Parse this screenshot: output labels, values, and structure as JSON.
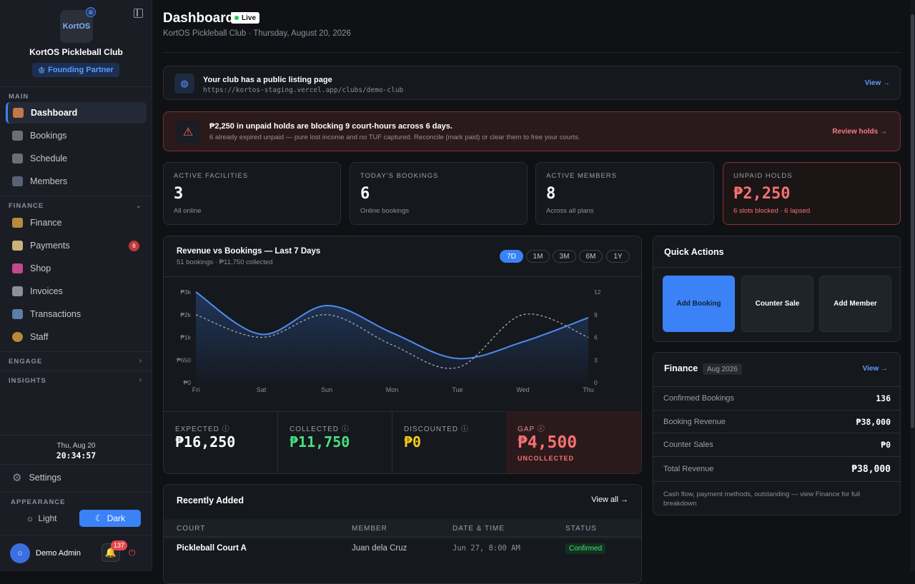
{
  "sidebar": {
    "logo_text": "KortOS",
    "club_name": "KortOS Pickleball Club",
    "partner_badge": "Founding Partner",
    "sections": {
      "main": "MAIN",
      "finance": "FINANCE",
      "engage": "ENGAGE",
      "insights": "INSIGHTS",
      "appearance": "APPEARANCE"
    },
    "main_items": [
      {
        "label": "Dashboard",
        "icon": "house-icon"
      },
      {
        "label": "Bookings",
        "icon": "calendar-icon"
      },
      {
        "label": "Schedule",
        "icon": "calendar-icon"
      },
      {
        "label": "Members",
        "icon": "people-icon"
      }
    ],
    "finance_items": [
      {
        "label": "Finance",
        "icon": "money-bag-icon"
      },
      {
        "label": "Payments",
        "icon": "credit-card-icon",
        "badge": "6"
      },
      {
        "label": "Shop",
        "icon": "shopping-bags-icon"
      },
      {
        "label": "Invoices",
        "icon": "document-icon"
      },
      {
        "label": "Transactions",
        "icon": "exchange-icon"
      },
      {
        "label": "Staff",
        "icon": "staff-icon"
      }
    ],
    "clock_date": "Thu, Aug 20",
    "clock_time": "20:34:57",
    "settings": "Settings",
    "theme_light": "Light",
    "theme_dark": "Dark",
    "user_name": "Demo Admin",
    "notifications": "137"
  },
  "header": {
    "title": "Dashboard",
    "live": "Live",
    "subtitle": "KortOS Pickleball Club · Thursday, August 20, 2026"
  },
  "public_listing": {
    "title": "Your club has a public listing page",
    "url": "https://kortos-staging.vercel.app/clubs/demo-club",
    "link": "View →"
  },
  "alert": {
    "title": "₱2,250 in unpaid holds are blocking 9 court-hours across 6 days.",
    "body": "6 already expired unpaid — pure lost income and no TUF captured. Reconcile (mark paid) or clear them to free your courts.",
    "link": "Review holds →"
  },
  "stats": [
    {
      "label": "ACTIVE FACILITIES",
      "value": "3",
      "sub": "All online"
    },
    {
      "label": "TODAY'S BOOKINGS",
      "value": "6",
      "sub": "Online bookings"
    },
    {
      "label": "ACTIVE MEMBERS",
      "value": "8",
      "sub": "Across all plans"
    },
    {
      "label": "UNPAID HOLDS",
      "value": "₱2,250",
      "sub": "6 slots blocked · 6 lapsed"
    }
  ],
  "revenue": {
    "title": "Revenue vs Bookings — Last 7 Days",
    "subtitle": "51 bookings · ₱11,750 collected",
    "ranges": [
      "7D",
      "1M",
      "3M",
      "6M",
      "1Y"
    ],
    "kpis": [
      {
        "label": "EXPECTED",
        "value": "₱16,250",
        "color": "#ffffff"
      },
      {
        "label": "COLLECTED",
        "value": "₱11,750",
        "color": "#4ade80"
      },
      {
        "label": "DISCOUNTED",
        "value": "₱0",
        "color": "#facc15"
      },
      {
        "label": "GAP",
        "value": "₱4,500",
        "color": "#f87171",
        "sub": "UNCOLLECTED"
      }
    ]
  },
  "chart_data": {
    "type": "line",
    "categories": [
      "Fri",
      "Sat",
      "Sun",
      "Mon",
      "Tue",
      "Wed",
      "Thu"
    ],
    "y_left_ticks": [
      "₱0",
      "₱650",
      "₱1k",
      "₱2k",
      "₱3k"
    ],
    "y_right_ticks": [
      "0",
      "3",
      "6",
      "9",
      "12"
    ],
    "series": [
      {
        "values": [
          3000,
          1600,
          2550,
          1650,
          800,
          1350,
          2150
        ],
        "color": "#4f8bf0",
        "axis": "left"
      },
      {
        "values": [
          9,
          6,
          9,
          5,
          2,
          9,
          6
        ],
        "color": "#a8adb6",
        "axis": "right",
        "dashed": true
      }
    ],
    "ylim_left": [
      0,
      3000
    ],
    "ylim_right": [
      0,
      12
    ]
  },
  "quick_actions": {
    "title": "Quick Actions",
    "buttons": [
      "Add Booking",
      "Counter Sale",
      "Add Member"
    ]
  },
  "finance": {
    "title": "Finance",
    "period": "Aug 2026",
    "link": "View →",
    "rows": [
      {
        "label": "Confirmed Bookings",
        "value": "136"
      },
      {
        "label": "Booking Revenue",
        "value": "₱38,000"
      },
      {
        "label": "Counter Sales",
        "value": "₱0"
      },
      {
        "label": "Total Revenue",
        "value": "₱38,000"
      }
    ],
    "note": "Cash flow, payment methods, outstanding — view Finance for full breakdown"
  },
  "recent": {
    "title": "Recently Added",
    "link": "View all →",
    "columns": [
      "COURT",
      "MEMBER",
      "DATE & TIME",
      "STATUS"
    ],
    "rows": [
      {
        "court": "Pickleball Court A",
        "member": "Juan dela Cruz",
        "datetime": "Jun 27, 8:00 AM",
        "status": "Confirmed"
      }
    ]
  }
}
